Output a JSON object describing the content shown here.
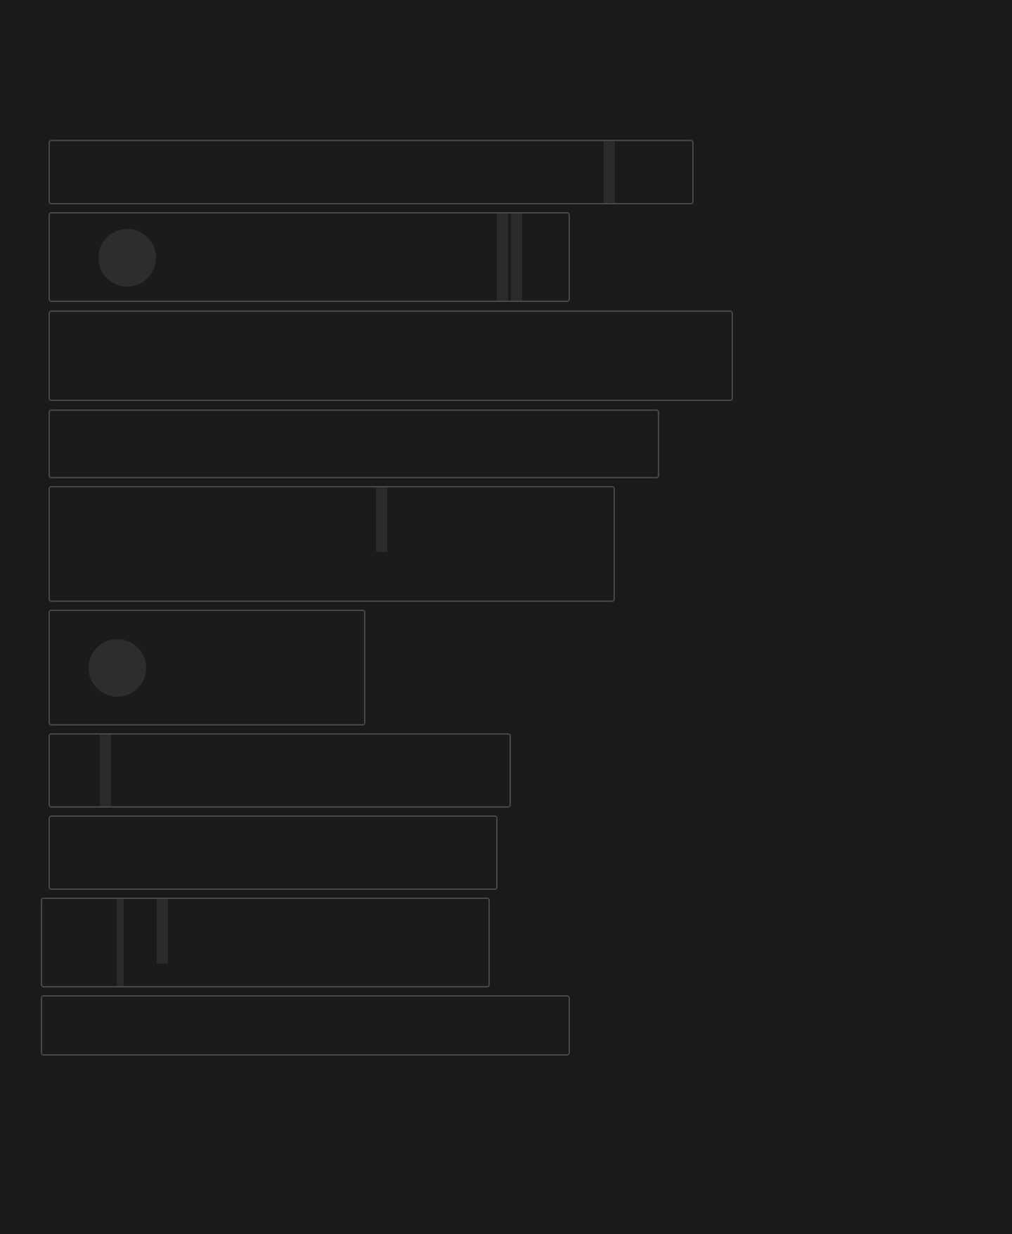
{
  "loading_placeholder": {
    "state": "loading",
    "card_count": 10,
    "colors": {
      "background": "#1a1a1a",
      "card_border": "#474747",
      "shimmer": "#2b2a29",
      "avatar": "#2e2d2c"
    }
  }
}
